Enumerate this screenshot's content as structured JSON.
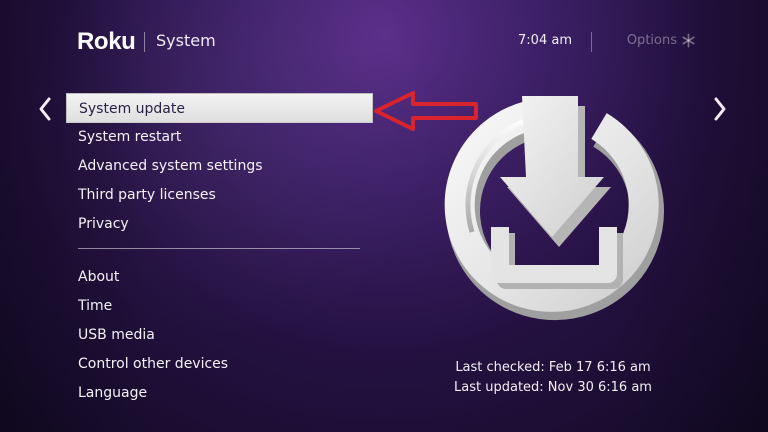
{
  "header": {
    "brand": "Roku",
    "title": "System",
    "time": "7:04 am",
    "options_label": "Options"
  },
  "icons": {
    "left_nav": "chevron-left",
    "right_nav": "chevron-right",
    "options": "asterisk",
    "pointer": "red-left-arrow",
    "hero": "system-update-download"
  },
  "menu": {
    "items": [
      {
        "label": "System update",
        "selected": true
      },
      {
        "label": "System restart"
      },
      {
        "label": "Advanced system settings"
      },
      {
        "label": "Third party licenses"
      },
      {
        "label": "Privacy"
      },
      {
        "label": "About"
      },
      {
        "label": "Time"
      },
      {
        "label": "USB media"
      },
      {
        "label": "Control other devices"
      },
      {
        "label": "Language"
      }
    ]
  },
  "status": {
    "last_checked": "Last checked: Feb 17  6:16 am",
    "last_updated": "Last updated: Nov 30  6:16 am"
  },
  "colors": {
    "background_top": "#5a2f8a",
    "background_bottom": "#120a24",
    "selected_background": "#e8e8e8",
    "selected_text": "#2a1f45",
    "annotation_arrow": "#d9232d"
  }
}
